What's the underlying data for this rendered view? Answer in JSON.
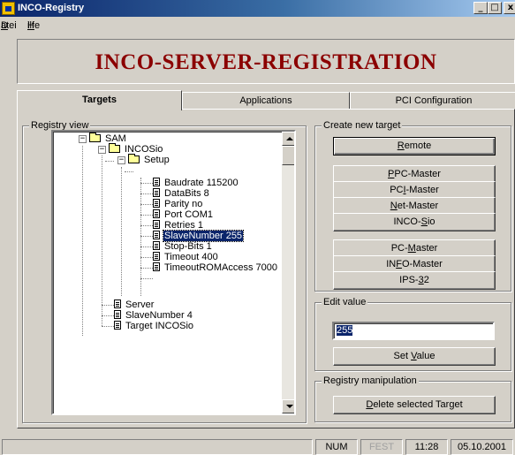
{
  "window": {
    "title": "INCO-Registry",
    "min_label": "_",
    "max_label": "□",
    "close_label": "x"
  },
  "menu": {
    "datei": "Datei",
    "datei_accel": "D",
    "datei_rest": "atei",
    "hilfe_accel": "H",
    "hilfe_rest": "ilfe"
  },
  "banner": {
    "title": "INCO-SERVER-REGISTRATION",
    "color": "#8b0000"
  },
  "tabs": [
    {
      "label": "Targets",
      "active": true
    },
    {
      "label": "Applications",
      "active": false
    },
    {
      "label": "PCI Configuration",
      "active": false
    }
  ],
  "registry_view": {
    "label": "Registry view",
    "nodes": [
      {
        "text": "SAM",
        "icon": "folder-open-icon"
      },
      {
        "text": "INCOSio",
        "icon": "folder-open-icon"
      },
      {
        "text": "Setup",
        "icon": "folder-open-icon"
      },
      {
        "text": "Baudrate  115200",
        "icon": "document-icon"
      },
      {
        "text": "DataBits  8",
        "icon": "document-icon"
      },
      {
        "text": "Parity  no",
        "icon": "document-icon"
      },
      {
        "text": "Port  COM1",
        "icon": "document-icon"
      },
      {
        "text": "Retries  1",
        "icon": "document-icon"
      },
      {
        "text": "SlaveNumber  255",
        "icon": "document-icon",
        "selected": true
      },
      {
        "text": "Stop-Bits  1",
        "icon": "document-icon"
      },
      {
        "text": "Timeout  400",
        "icon": "document-icon"
      },
      {
        "text": "TimeoutROMAccess  7000",
        "icon": "document-icon"
      },
      {
        "text": "Server",
        "icon": "document-icon"
      },
      {
        "text": "SlaveNumber  4",
        "icon": "document-icon"
      },
      {
        "text": "Target  INCOSio",
        "icon": "document-icon"
      }
    ],
    "expander": "−"
  },
  "create_target": {
    "label": "Create new target",
    "remote": {
      "pre": "",
      "accel": "R",
      "post": "emote"
    },
    "ppc": {
      "pre": "",
      "accel": "P",
      "post": "PC-Master"
    },
    "pci": {
      "pre": "PC",
      "accel": "I",
      "post": "-Master"
    },
    "net": {
      "pre": "",
      "accel": "N",
      "post": "et-Master"
    },
    "incosio": {
      "pre": "INCO-",
      "accel": "S",
      "post": "io"
    },
    "pc": {
      "pre": "PC-",
      "accel": "M",
      "post": "aster"
    },
    "info": {
      "pre": "IN",
      "accel": "F",
      "post": "O-Master"
    },
    "ips": {
      "pre": "IPS-",
      "accel": "3",
      "post": "2"
    }
  },
  "edit_value": {
    "label": "Edit value",
    "value": "255",
    "set": {
      "pre": "Set ",
      "accel": "V",
      "post": "alue"
    }
  },
  "registry_manipulation": {
    "label": "Registry manipulation",
    "delete": {
      "pre": "",
      "accel": "D",
      "post": "elete selected Target"
    }
  },
  "status": {
    "num": "NUM",
    "fest": "FEST",
    "time": "11:28",
    "date": "05.10.2001"
  }
}
